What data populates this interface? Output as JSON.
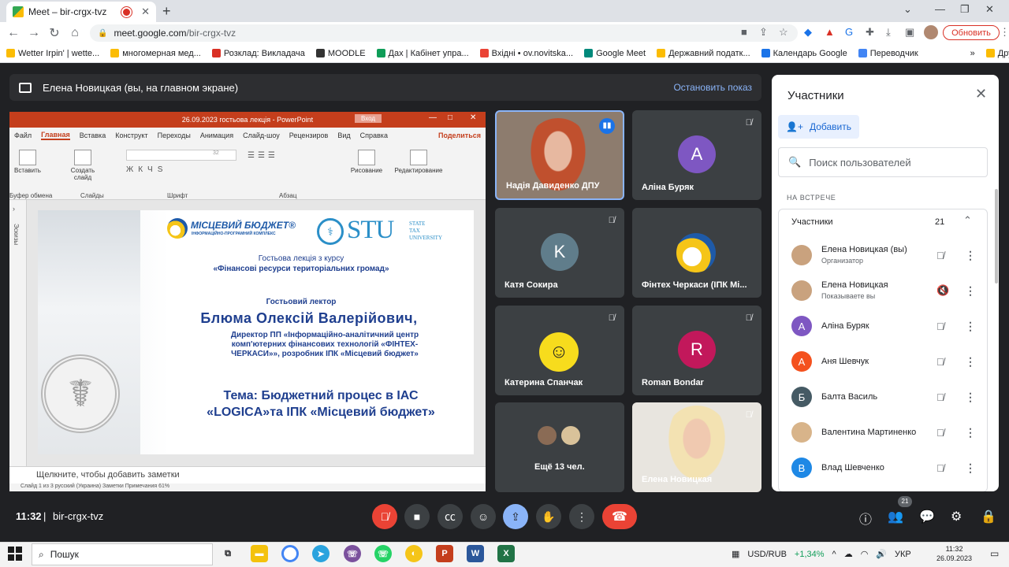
{
  "browser": {
    "tab_title": "Meet – bir-crgx-tvz",
    "url_host": "meet.google.com",
    "url_path": "/bir-crgx-tvz",
    "update_button": "Обновить",
    "bookmarks": [
      "Wetter Irpin' | wette...",
      "многомерная мед...",
      "Розклад: Викладача",
      "MOODLE",
      "Дах | Кабінет упра...",
      "Вхідні • ov.novitska...",
      "Google Meet",
      "Державний податк...",
      "Календарь Google",
      "Переводчик",
      "Другие закладки"
    ]
  },
  "meet": {
    "presenting_banner": "Елена Новицкая (вы, на главном экране)",
    "stop_presenting": "Остановить показ",
    "time": "11:32",
    "meeting_code": "bir-crgx-tvz",
    "participants_badge": "21"
  },
  "powerpoint": {
    "title": "26.09.2023 гостьова лекція  -  PowerPoint",
    "login": "Вход",
    "menu": [
      "Файл",
      "Главная",
      "Вставка",
      "Конструкт",
      "Переходы",
      "Анимация",
      "Слайд-шоу",
      "Рецензиров",
      "Вид",
      "Справка"
    ],
    "share": "Поделиться",
    "ribbon": {
      "paste": "Вставить",
      "create_slide": "Создать слайд",
      "drawing": "Рисование",
      "editing": "Редактирование",
      "groups": [
        "Буфер обмена",
        "Слайды",
        "Шрифт",
        "Абзац"
      ],
      "font_size": "32"
    },
    "thumbnails_label": "Эскизы",
    "notes_placeholder": "Щелкните, чтобы добавить заметки",
    "status": "Слайд 1 из 3     русский (Украина)               Заметки        Примечания                      61%"
  },
  "slide": {
    "logo1_title": "МІСЦЕВИЙ БЮДЖЕТ®",
    "logo1_sub": "ІНФОРМАЦІЙНО-ПРОГРАМНИЙ КОМПЛЕКС",
    "logo2_title": "STU",
    "logo2_sub": [
      "STATE",
      "TAX",
      "UNIVERSITY"
    ],
    "course_line1": "Гостьова лекція з курсу",
    "course_line2": "«Фінансові ресурси територіальних громад»",
    "guest_label": "Гостьовий лектор",
    "lecturer": "Блюма Олексій Валерійович,",
    "position_line1": "Директор ПП «Інформаційно-аналітичний центр",
    "position_line2": "комп'ютерних фінансових технологій «ФІНТЕХ-",
    "position_line3": "ЧЕРКАСИ»», розробник ІПК «Місцевий бюджет»",
    "topic_line1": "Тема: Бюджетний процес в ІАС",
    "topic_line2": "«LOGICA»та ІПК «Місцевий бюджет»"
  },
  "tiles": [
    {
      "name": "Надія Давиденко ДПУ"
    },
    {
      "name": "Аліна Буряк",
      "initial": "A",
      "color": "#7e57c2"
    },
    {
      "name": "Катя Сокира",
      "initial": "K",
      "color": "#607d8b"
    },
    {
      "name": "Фінтех Черкаси (ІПК Мі..."
    },
    {
      "name": "Катерина Спанчак"
    },
    {
      "name": "Roman Bondar",
      "initial": "R",
      "color": "#c2185b"
    },
    {
      "name": "Ещё 13 чел."
    },
    {
      "name": "Елена Новицкая"
    }
  ],
  "panel": {
    "title": "Участники",
    "add": "Добавить",
    "search_placeholder": "Поиск пользователей",
    "section": "НА ВСТРЕЧЕ",
    "group_label": "Участники",
    "group_count": "21",
    "people": [
      {
        "name": "Елена Новицкая (вы)",
        "sub": "Организатор",
        "initial": "",
        "color": "#c9a27e"
      },
      {
        "name": "Елена Новицкая",
        "sub": "Показываете вы",
        "initial": "",
        "color": "#c9a27e"
      },
      {
        "name": "Аліна Буряк",
        "sub": "",
        "initial": "A",
        "color": "#7e57c2"
      },
      {
        "name": "Аня Шевчук",
        "sub": "",
        "initial": "A",
        "color": "#f4511e"
      },
      {
        "name": "Балта Василь",
        "sub": "",
        "initial": "Б",
        "color": "#455a64"
      },
      {
        "name": "Валентина Мартиненко",
        "sub": "",
        "initial": "",
        "color": "#d8b48a"
      },
      {
        "name": "Влад Шевченко",
        "sub": "",
        "initial": "B",
        "color": "#1e88e5"
      }
    ]
  },
  "taskbar": {
    "search": "Пошук",
    "currency": "USD/RUB",
    "change": "+1,34%",
    "lang": "УКР",
    "time": "11:32",
    "date": "26.09.2023"
  }
}
